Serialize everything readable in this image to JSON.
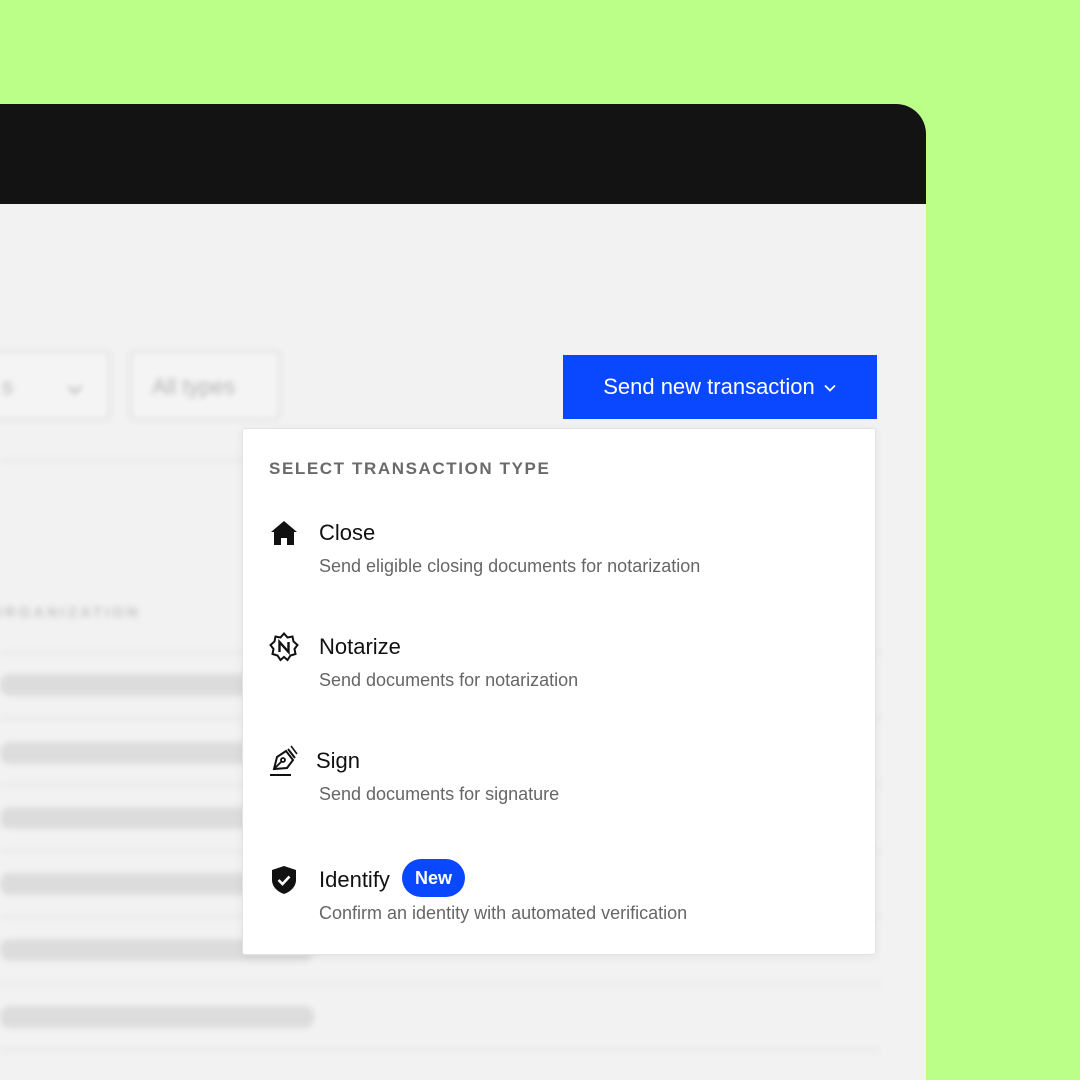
{
  "header": {
    "send_button_label": "Send new transaction"
  },
  "filters": [
    {
      "value": "s"
    },
    {
      "value": "All types"
    }
  ],
  "table": {
    "column_header": "ORGANIZATION"
  },
  "dropdown": {
    "heading": "SELECT TRANSACTION TYPE",
    "items": [
      {
        "title": "Close",
        "description": "Send eligible closing documents for notarization",
        "icon": "house-icon"
      },
      {
        "title": "Notarize",
        "description": "Send documents for notarization",
        "icon": "notarize-seal-icon"
      },
      {
        "title": "Sign",
        "description": "Send documents for signature",
        "icon": "pen-sign-icon"
      },
      {
        "title": "Identify",
        "description": "Confirm an identity with automated verification",
        "icon": "shield-check-icon",
        "badge": "New"
      }
    ]
  },
  "colors": {
    "background": "#bbff88",
    "window_bar": "#131313",
    "accent_blue": "#0a48ff",
    "panel": "#f2f2f2"
  }
}
